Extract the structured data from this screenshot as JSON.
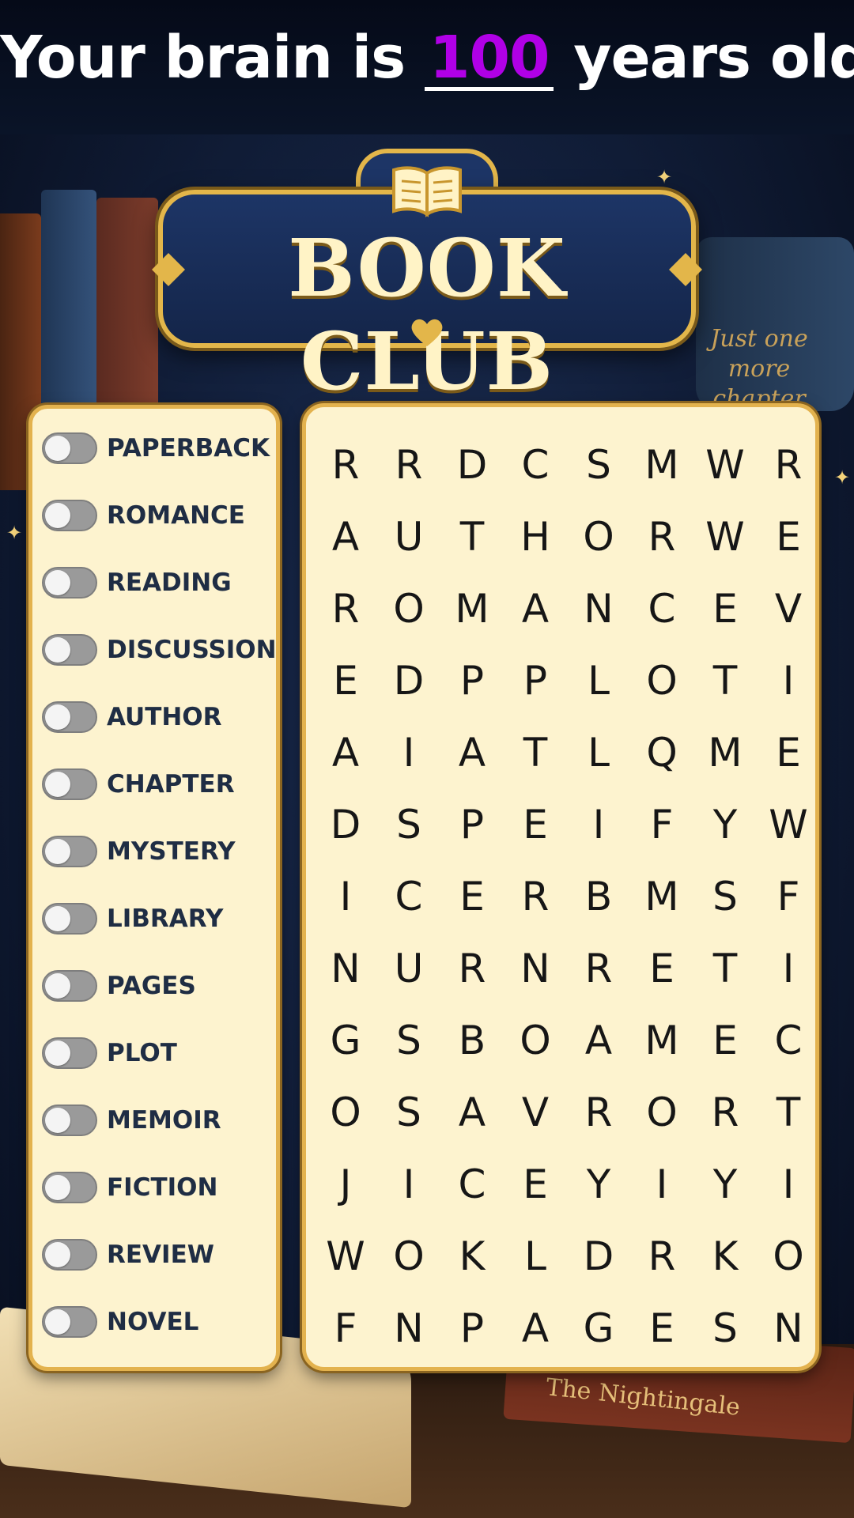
{
  "header": {
    "prefix": "Your brain is",
    "age": "100",
    "suffix": "years old."
  },
  "logo": {
    "title": "BOOK CLUB",
    "icon": "open-book-icon"
  },
  "decor": {
    "mug_text": "Just one more chapter",
    "book_title": "The Nightingale"
  },
  "colors": {
    "age_highlight": "#b000e6",
    "panel_bg": "#fdf3cf",
    "panel_border": "#e3b24e",
    "toggle_off": "#9a9a9a"
  },
  "words": [
    {
      "label": "PAPERBACK",
      "found": false
    },
    {
      "label": "ROMANCE",
      "found": false
    },
    {
      "label": "READING",
      "found": false
    },
    {
      "label": "DISCUSSION",
      "found": false
    },
    {
      "label": "AUTHOR",
      "found": false
    },
    {
      "label": "CHAPTER",
      "found": false
    },
    {
      "label": "MYSTERY",
      "found": false
    },
    {
      "label": "LIBRARY",
      "found": false
    },
    {
      "label": "PAGES",
      "found": false
    },
    {
      "label": "PLOT",
      "found": false
    },
    {
      "label": "MEMOIR",
      "found": false
    },
    {
      "label": "FICTION",
      "found": false
    },
    {
      "label": "REVIEW",
      "found": false
    },
    {
      "label": "NOVEL",
      "found": false
    }
  ],
  "grid": [
    [
      "R",
      "R",
      "D",
      "C",
      "S",
      "M",
      "W",
      "R"
    ],
    [
      "A",
      "U",
      "T",
      "H",
      "O",
      "R",
      "W",
      "E"
    ],
    [
      "R",
      "O",
      "M",
      "A",
      "N",
      "C",
      "E",
      "V"
    ],
    [
      "E",
      "D",
      "P",
      "P",
      "L",
      "O",
      "T",
      "I"
    ],
    [
      "A",
      "I",
      "A",
      "T",
      "L",
      "Q",
      "M",
      "E"
    ],
    [
      "D",
      "S",
      "P",
      "E",
      "I",
      "F",
      "Y",
      "W"
    ],
    [
      "I",
      "C",
      "E",
      "R",
      "B",
      "M",
      "S",
      "F"
    ],
    [
      "N",
      "U",
      "R",
      "N",
      "R",
      "E",
      "T",
      "I"
    ],
    [
      "G",
      "S",
      "B",
      "O",
      "A",
      "M",
      "E",
      "C"
    ],
    [
      "O",
      "S",
      "A",
      "V",
      "R",
      "O",
      "R",
      "T"
    ],
    [
      "J",
      "I",
      "C",
      "E",
      "Y",
      "I",
      "Y",
      "I"
    ],
    [
      "W",
      "O",
      "K",
      "L",
      "D",
      "R",
      "K",
      "O"
    ],
    [
      "F",
      "N",
      "P",
      "A",
      "G",
      "E",
      "S",
      "N"
    ]
  ]
}
